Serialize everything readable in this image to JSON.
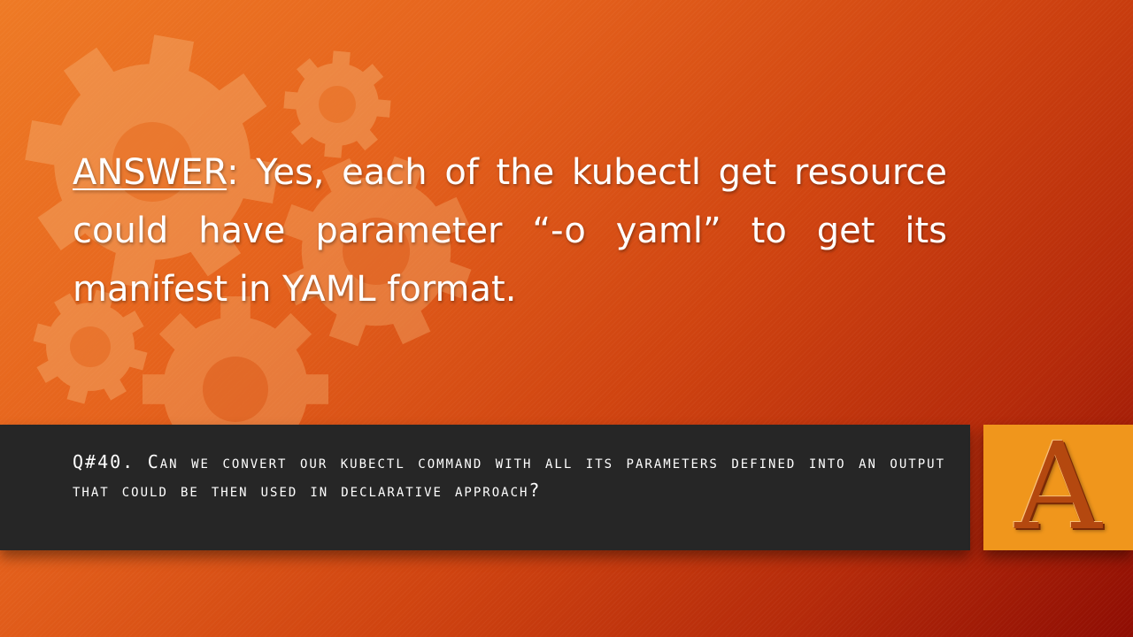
{
  "slide": {
    "colors": {
      "background_start": "#ee7a25",
      "background_end": "#8f0d03",
      "question_bar": "#262626",
      "badge": "#f0961c",
      "badge_letter": "#b4480f",
      "text": "#ffffff"
    },
    "decoration_icons": [
      "gear-icon",
      "gear-icon",
      "gear-icon",
      "gear-icon",
      "gear-icon"
    ]
  },
  "answer": {
    "label": "ANSWER",
    "text": ": Yes, each of the kubectl get resource could have parameter “-o yaml” to get its manifest in YAML format."
  },
  "question": {
    "text": "Q#40. Can we convert our kubectl command with all its parameters defined into an output that could be then used in declarative approach?"
  },
  "badge": {
    "letter": "A"
  }
}
